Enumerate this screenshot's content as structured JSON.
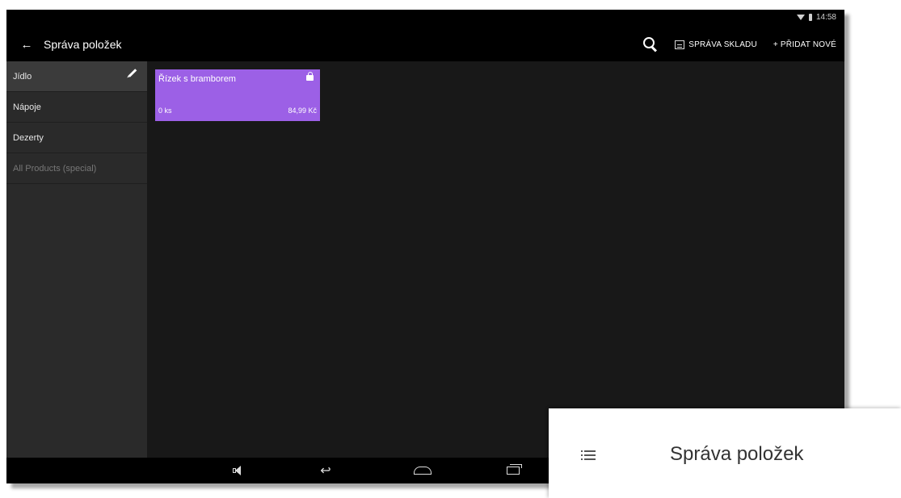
{
  "status_bar": {
    "time": "14:58"
  },
  "action_bar": {
    "title": "Správa položek",
    "search_icon": "search-icon",
    "stock_management_label": "SPRÁVA SKLADU",
    "add_new_label": "+ PŘIDAT NOVÉ"
  },
  "sidebar": {
    "items": [
      {
        "label": "Jídlo",
        "active": true
      },
      {
        "label": "Nápoje",
        "active": false
      },
      {
        "label": "Dezerty",
        "active": false
      },
      {
        "label": "All Products (special)",
        "active": false
      }
    ]
  },
  "products": [
    {
      "name": "Řízek s bramborem",
      "quantity": "0 ks",
      "price": "84,99 Kč",
      "color": "#9c60e6"
    }
  ],
  "callout": {
    "title": "Správa položek",
    "icon": "list-icon"
  }
}
